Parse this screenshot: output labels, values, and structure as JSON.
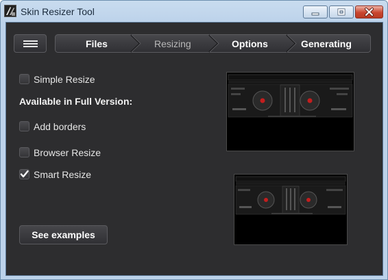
{
  "window": {
    "title": "Skin Resizer Tool",
    "buttons": [
      "minimize",
      "maximize",
      "close"
    ]
  },
  "toolbar": {
    "menu_icon": "hamburger-icon",
    "steps": [
      {
        "label": "Files",
        "state": "done"
      },
      {
        "label": "Resizing",
        "state": "current"
      },
      {
        "label": "Options",
        "state": "pending"
      },
      {
        "label": "Generating",
        "state": "pending"
      }
    ]
  },
  "options": {
    "simple_resize": {
      "label": "Simple Resize",
      "checked": false
    },
    "full_version_heading": "Available in Full Version:",
    "add_borders": {
      "label": "Add borders",
      "checked": false
    },
    "browser_resize": {
      "label": "Browser Resize",
      "checked": false
    },
    "smart_resize": {
      "label": "Smart Resize",
      "checked": true
    }
  },
  "actions": {
    "see_examples": "See examples"
  },
  "previews": [
    {
      "name": "original-skin-preview"
    },
    {
      "name": "resized-skin-preview"
    }
  ],
  "colors": {
    "window_frame": "#bcd2ea",
    "client_bg": "#2d2d2f",
    "close_button": "#c9462f",
    "active_text": "#ffffff",
    "inactive_text": "#b8b8b8"
  }
}
